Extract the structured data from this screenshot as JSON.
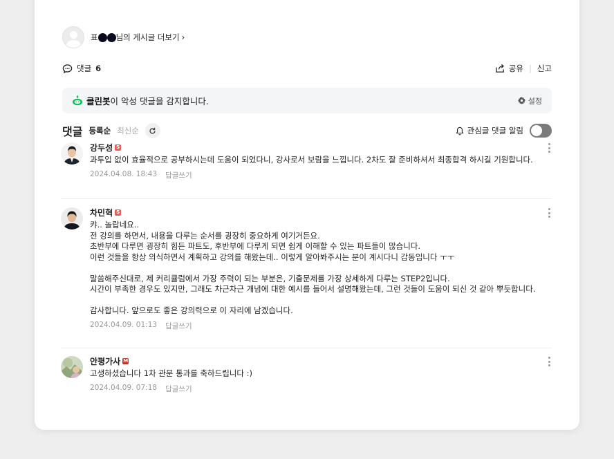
{
  "author": {
    "name_prefix": "표",
    "name_suffix": "님의 게시글 더보기",
    "chevron": "›"
  },
  "comments_header": {
    "label": "댓글",
    "count": "6",
    "share_label": "공유",
    "report_label": "신고"
  },
  "cleanbot": {
    "brand": "클린봇",
    "message": "이 악성 댓글을 감지합니다.",
    "settings_label": "설정",
    "accent": "#03c75a"
  },
  "sort": {
    "title": "댓글",
    "active": "등록순",
    "inactive": "최신순",
    "notify_label": "관심글 댓글 알림"
  },
  "comments": [
    {
      "name": "강두성",
      "badge": "S",
      "text": "과투입 없이 효율적으로 공부하시는데 도움이 되었다니, 강사로서 보람을 느낍니다. 2차도 잘 준비하셔서 최종합격 하시길 기원합니다.",
      "date": "2024.04.08. 18:43",
      "reply_label": "답글쓰기"
    },
    {
      "name": "차민혁",
      "badge": "S",
      "text": "캬.. 놀랍네요..\n전 강의를 하면서, 내용을 다루는 순서를 굉장히 중요하게 여기거든요.\n초반부에 다루면 굉장히 힘든 파트도, 후반부에 다루게 되면 쉽게 이해할 수 있는 파트들이 많습니다.\n이런 것들을 항상 의식하면서 계획하고 강의를 해왔는데.. 이렇게 알아봐주시는 분이 계시다니 감동입니다 ㅜㅜ\n\n말씀해주신대로, 제 커리큘럼에서 가장 주력이 되는 부분은, 기출문제를 가장 상세하게 다루는 STEP2입니다.\n시간이 부족한 경우도 있지만, 그래도 차근차근 개념에 대한 예시를 들어서 설명해왔는데, 그런 것들이 도움이 되신 것 같아 뿌듯합니다.\n\n감사합니다. 앞으로도 좋은 강의력으로 이 자리에 남겠습니다.",
      "date": "2024.04.09. 01:13",
      "reply_label": "답글쓰기"
    },
    {
      "name": "안평가사",
      "badge": "M",
      "text": "고생하셨습니다 1차 관문 통과를 축하드립니다 :)",
      "date": "2024.04.09. 07:18",
      "reply_label": "답글쓰기"
    }
  ]
}
